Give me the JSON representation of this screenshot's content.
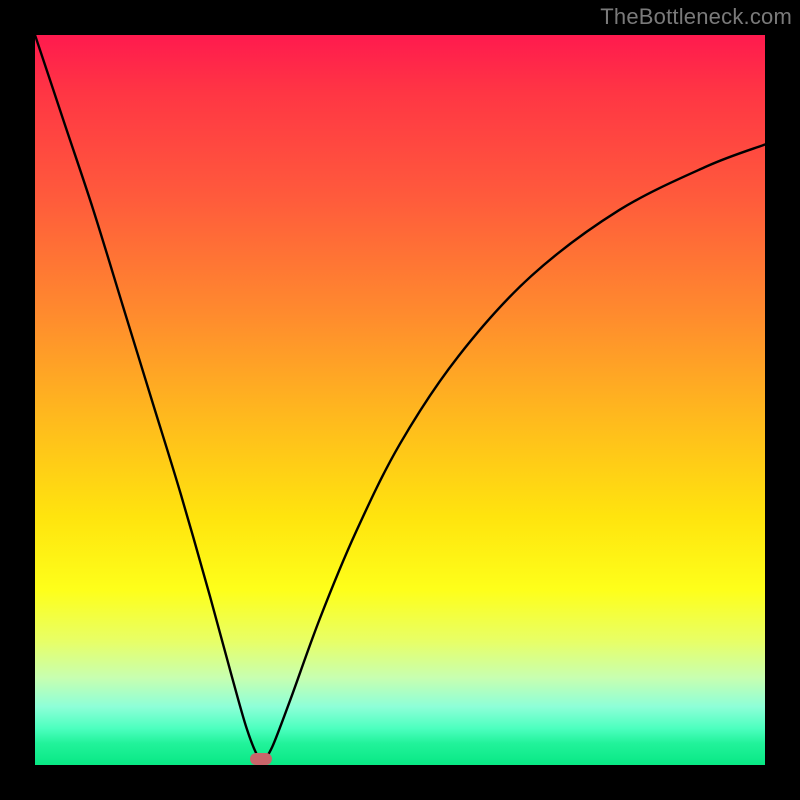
{
  "watermark": "TheBottleneck.com",
  "chart_data": {
    "type": "line",
    "title": "",
    "xlabel": "",
    "ylabel": "",
    "xlim": [
      0,
      100
    ],
    "ylim": [
      0,
      100
    ],
    "grid": false,
    "series": [
      {
        "name": "bottleneck-curve",
        "x": [
          0,
          4,
          8,
          12,
          16,
          20,
          24,
          27,
          29,
          30.5,
          31.3,
          32.5,
          35,
          39,
          44,
          50,
          58,
          68,
          80,
          92,
          100
        ],
        "y": [
          100,
          88,
          76,
          63,
          50,
          37,
          23,
          12,
          5,
          1.2,
          0.8,
          2.5,
          9,
          20,
          32,
          44,
          56,
          67,
          76,
          82,
          85
        ]
      }
    ],
    "minimum_marker": {
      "x": 31,
      "y": 0.8
    },
    "background_gradient": {
      "top": "#ff1a4e",
      "mid_high": "#ffb81e",
      "mid_low": "#feff1a",
      "bottom": "#08e884"
    }
  }
}
